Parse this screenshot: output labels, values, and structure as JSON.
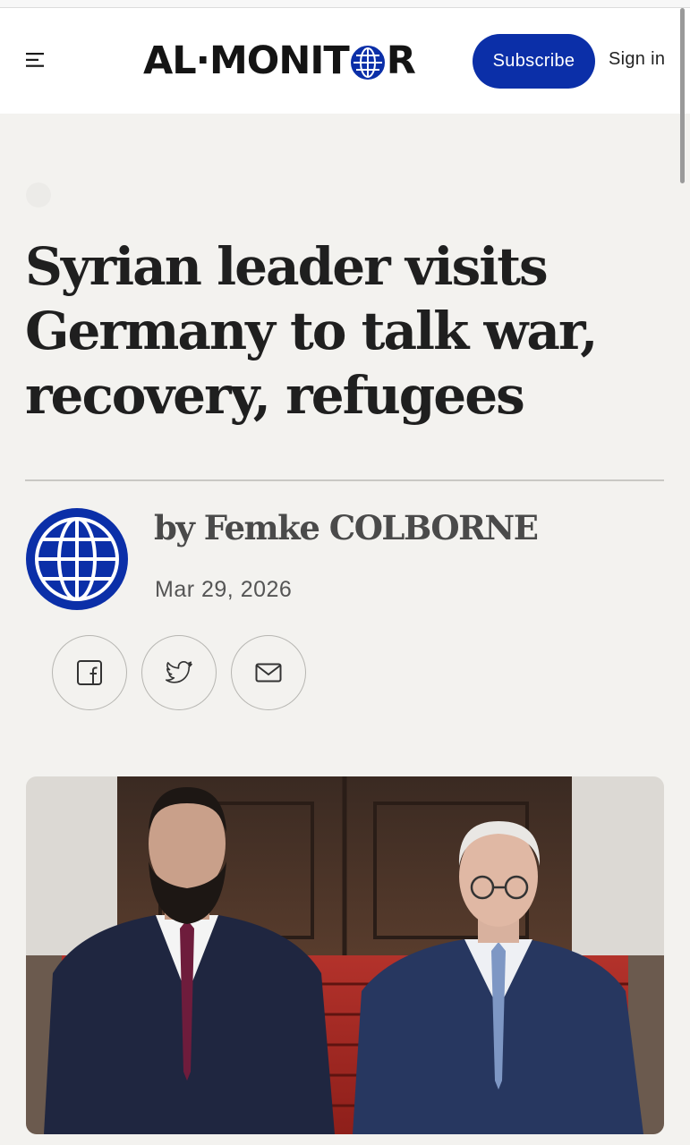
{
  "header": {
    "logo": {
      "text_left": "AL·MONIT",
      "text_right": "R",
      "alt": "AL-MONITOR"
    },
    "subscribe_label": "Subscribe",
    "signin_label": "Sign in",
    "menu_icon": "hamburger-menu-icon"
  },
  "article": {
    "headline": "Syrian leader visits Germany to talk war, recovery, refugees",
    "byline": "by Femke COLBORNE",
    "date": "Mar 29, 2026",
    "share": [
      {
        "name": "facebook",
        "icon": "facebook-icon"
      },
      {
        "name": "twitter",
        "icon": "twitter-icon"
      },
      {
        "name": "email",
        "icon": "mail-icon"
      }
    ],
    "hero_image": {
      "depicts": "two men in dark suits standing on red-carpeted steps in front of a wooden door"
    }
  },
  "colors": {
    "brand_blue": "#0b2fa8",
    "page_bg": "#f3f2ef",
    "header_bg": "#ffffff",
    "headline_text": "#1f1f1f",
    "byline_text": "#4a4a4a"
  }
}
